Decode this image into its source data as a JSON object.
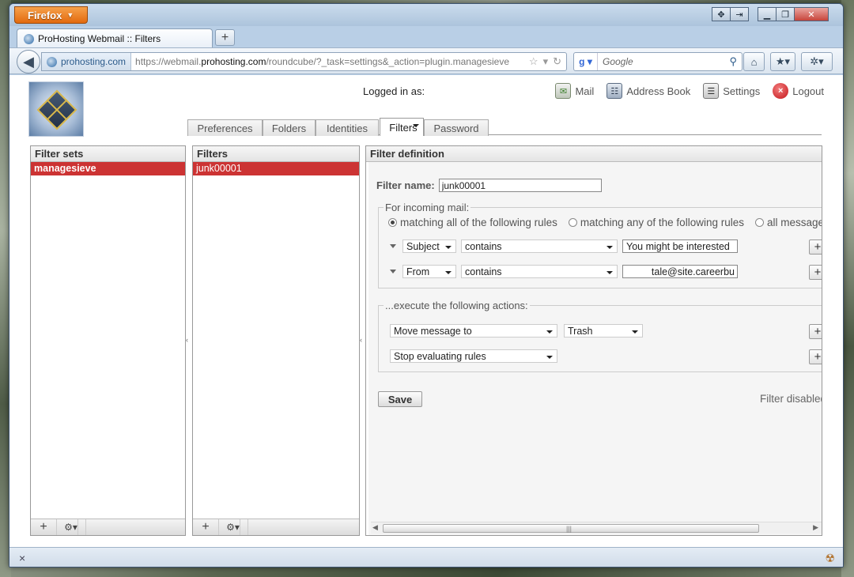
{
  "browser": {
    "app_button": "Firefox",
    "tab_title": "ProHosting Webmail :: Filters",
    "new_tab": "+",
    "identity_domain": "prohosting.com",
    "url_prefix": "https://webmail.",
    "url_domain": "prohosting.com",
    "url_suffix": "/roundcube/?_task=settings&_action=plugin.managesieve",
    "search_placeholder": "Google"
  },
  "header": {
    "logged_in_label": "Logged in as:",
    "nav": {
      "mail": "Mail",
      "address_book": "Address Book",
      "settings": "Settings",
      "logout": "Logout"
    }
  },
  "tabs": [
    {
      "label": "Preferences",
      "selected": false
    },
    {
      "label": "Folders",
      "selected": false
    },
    {
      "label": "Identities",
      "selected": false
    },
    {
      "label": "Filters",
      "selected": true
    },
    {
      "label": "Password",
      "selected": false
    }
  ],
  "filter_sets": {
    "title": "Filter sets",
    "items": [
      "managesieve"
    ],
    "selected": "managesieve"
  },
  "filters": {
    "title": "Filters",
    "items": [
      "junk00001"
    ],
    "selected": "junk00001"
  },
  "filter_definition": {
    "title": "Filter definition",
    "name_label": "Filter name:",
    "name_value": "junk00001",
    "incoming_legend": "For incoming mail:",
    "match_options": [
      {
        "label": "matching all of the following rules",
        "checked": true
      },
      {
        "label": "matching any of the following rules",
        "checked": false
      },
      {
        "label": "all messages",
        "checked": false
      }
    ],
    "rules": [
      {
        "header": "Subject",
        "operator": "contains",
        "value": "You might be interested"
      },
      {
        "header": "From",
        "operator": "contains",
        "value": "tale@site.careerbu"
      }
    ],
    "actions_legend": "...execute the following actions:",
    "actions": [
      {
        "action": "Move message to",
        "target": "Trash"
      },
      {
        "action": "Stop evaluating rules",
        "target": ""
      }
    ],
    "save_label": "Save",
    "disabled_label": "Filter disabled"
  },
  "statusbar": {
    "close_glyph": "×"
  }
}
